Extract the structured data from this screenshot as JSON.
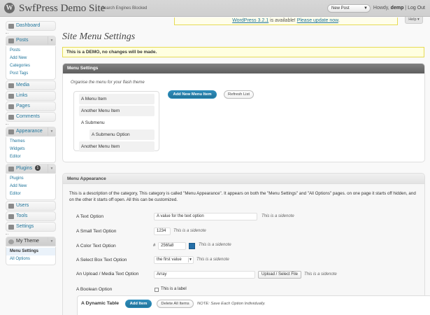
{
  "header": {
    "logo_glyph": "W",
    "site_title": "SwfPress Demo Site",
    "site_subtitle": "Search Engines Blocked",
    "favorite_action": "New Post",
    "howdy": "Howdy,",
    "username": "demp",
    "separator": "|",
    "logout": "Log Out"
  },
  "update_nag": {
    "link1": "WordPress 3.2.1",
    "text": "is available!",
    "link2": "Please update now",
    "dot": "."
  },
  "help_button": "Help ▾",
  "sidebar": {
    "dashboard": "Dashboard",
    "posts": "Posts",
    "posts_sub": [
      "Posts",
      "Add New",
      "Categories",
      "Post Tags"
    ],
    "media": "Media",
    "links": "Links",
    "pages": "Pages",
    "comments": "Comments",
    "appearance": "Appearance",
    "appearance_sub": [
      "Themes",
      "Widgets",
      "Editor"
    ],
    "plugins": "Plugins",
    "plugins_badge": "1",
    "plugins_sub": [
      "Plugins",
      "Add New",
      "Editor"
    ],
    "users": "Users",
    "tools": "Tools",
    "settings": "Settings",
    "my_theme": "My Theme",
    "my_theme_sub": [
      "Menu Settings",
      "All Options"
    ]
  },
  "page": {
    "title": "Site Menu Settings",
    "demo_notice": "This is a DEMO, no changes will be made."
  },
  "menu_settings": {
    "header": "Menu Settings",
    "instruction": "Organise the menu for your flash theme",
    "items": [
      "A Menu Item",
      "Another Menu Item",
      "A Submenu",
      "A Submenu Option",
      "Another Menu Item"
    ],
    "add_button": "Add New Menu Item",
    "refresh_button": "Refresh List"
  },
  "menu_appearance": {
    "header": "Menu Appearance",
    "description": "This is a description of the category, This category is called \"Menu Appearance\". It appears on both the \"Menu Settings\" and \"All Options\" pages. on one page it starts off hidden, and on the other it starts off open. All this can be customized.",
    "text_option_label": "A Text Option",
    "text_option_value": "A value for the text option",
    "text_option_note": "This is a sidenote",
    "small_text_label": "A Small Text Option",
    "small_text_value": "1234",
    "small_text_note": "This is a sidenote",
    "color_label": "A Color Text Option",
    "color_hash": "#",
    "color_value": "256fa8",
    "color_note": "This is a sidenote",
    "color_swatch": "#256fa8",
    "select_label": "A Select Box Text Option",
    "select_value": "the first value",
    "select_note": "This is a sidenote",
    "upload_label": "An Upload / Media Text Option",
    "upload_value": "Array",
    "upload_button": "Upload / Select File",
    "upload_note": "This is a sidenote",
    "boolean_label": "A Boolean Option",
    "boolean_checkbox_label": "This is a label",
    "dynamic_title": "A Dynamic Table",
    "add_item": "Add Item",
    "delete_all": "Delete All Items",
    "dynamic_note": "NOTE: Save Each Option Individually."
  }
}
